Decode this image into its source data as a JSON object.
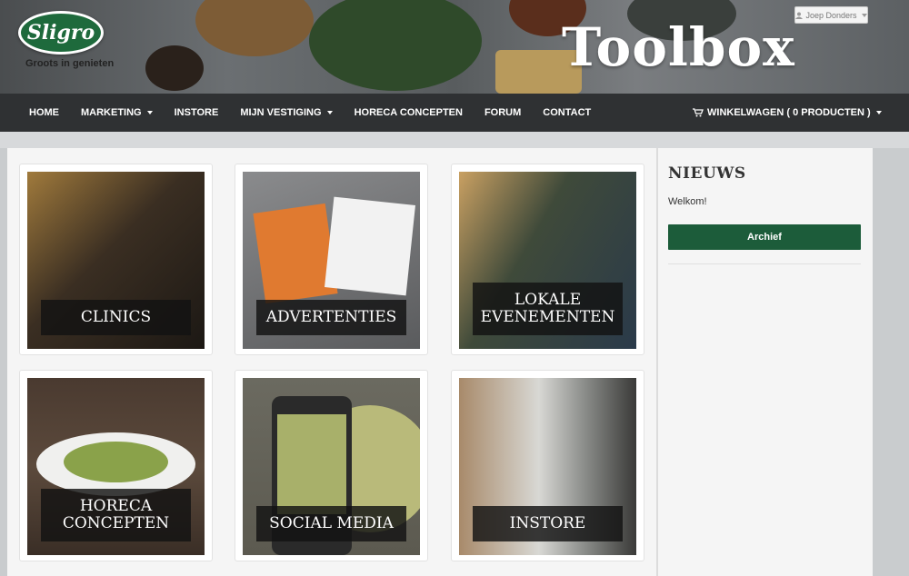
{
  "header": {
    "logo_text": "Sligro",
    "logo_tagline": "Groots in genieten",
    "title": "Toolbox",
    "user_name": "Joep Donders"
  },
  "nav": {
    "items": [
      {
        "label": "HOME",
        "dropdown": false
      },
      {
        "label": "MARKETING",
        "dropdown": true
      },
      {
        "label": "INSTORE",
        "dropdown": false
      },
      {
        "label": "MIJN VESTIGING",
        "dropdown": true
      },
      {
        "label": "HORECA CONCEPTEN",
        "dropdown": false
      },
      {
        "label": "FORUM",
        "dropdown": false
      },
      {
        "label": "CONTACT",
        "dropdown": false
      }
    ],
    "cart_label": "WINKELWAGEN ( 0 PRODUCTEN )"
  },
  "tiles": [
    {
      "label": "CLINICS",
      "bg": "#3a2e22"
    },
    {
      "label": "ADVERTENTIES",
      "bg": "#6d6e70"
    },
    {
      "label": "LOKALE\nEVENEMENTEN",
      "bg": "#3f4a3a"
    },
    {
      "label": "HORECA\nCONCEPTEN",
      "bg": "#4a3a30"
    },
    {
      "label": "SOCIAL MEDIA",
      "bg": "#5c5a50"
    },
    {
      "label": "INSTORE",
      "bg": "#8d8f8c"
    }
  ],
  "news": {
    "title": "NIEUWS",
    "text": "Welkom!",
    "button_label": "Archief"
  },
  "colors": {
    "nav_bg": "#2f3133",
    "button_green": "#1c5c3a",
    "logo_green": "#1e6a3c"
  }
}
